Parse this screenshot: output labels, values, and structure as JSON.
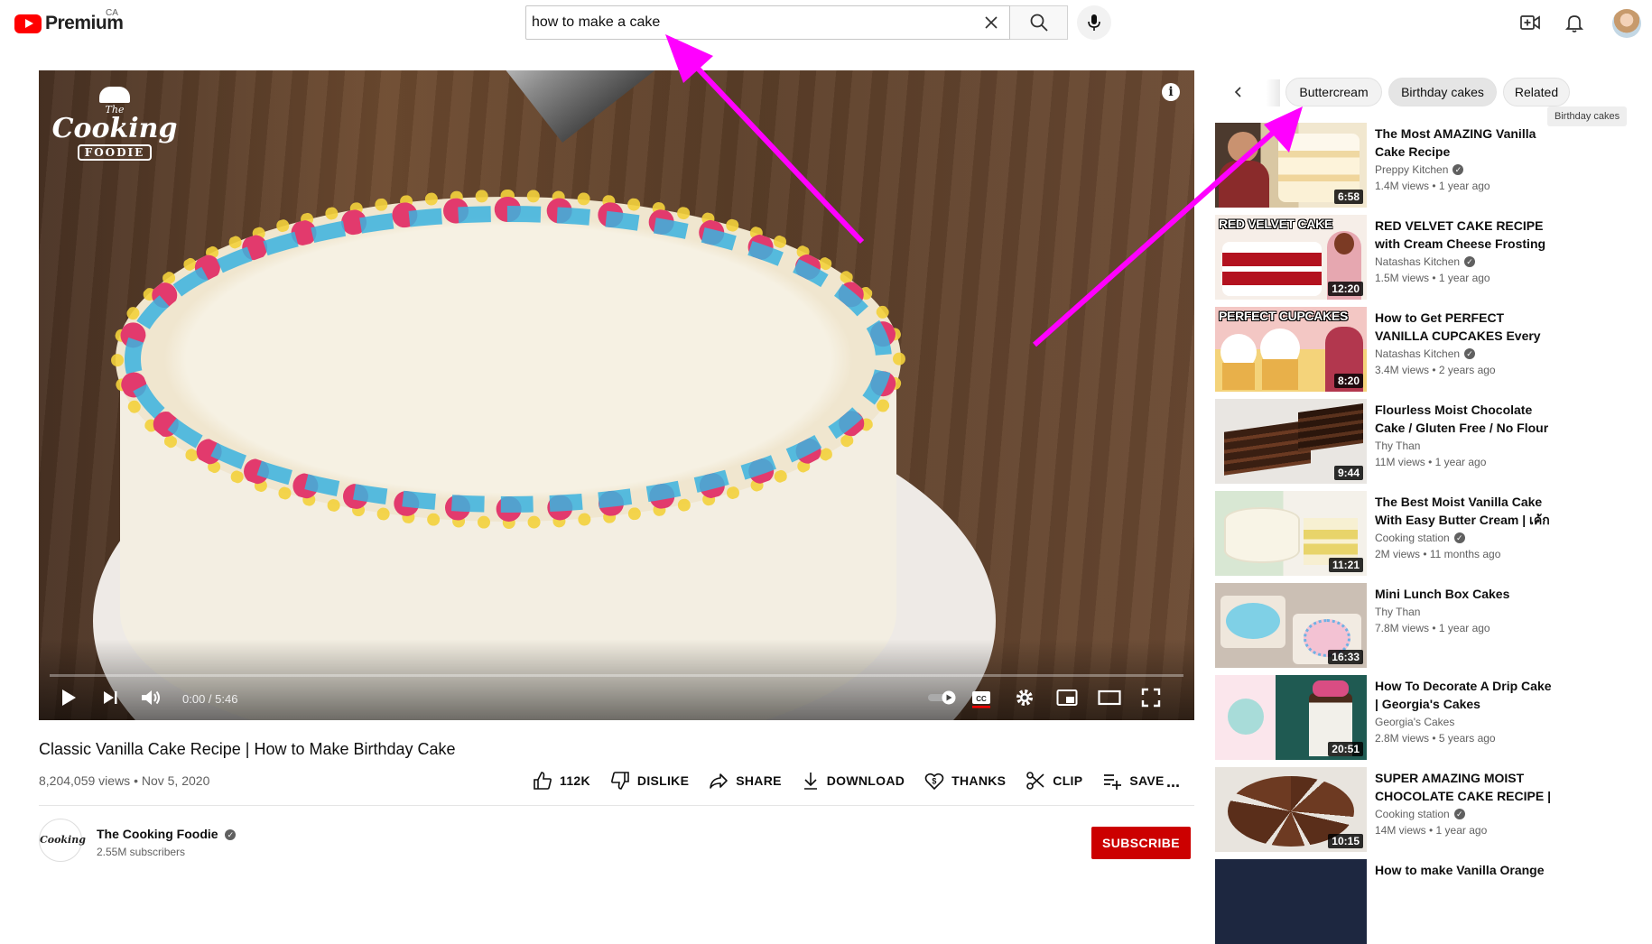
{
  "header": {
    "logo_text": "Premium",
    "country": "CA",
    "search_value": "how to make a cake",
    "icons": [
      "youtube-logo-icon",
      "close-icon",
      "search-icon",
      "mic-icon",
      "create-video-icon",
      "bell-icon",
      "avatar"
    ]
  },
  "player": {
    "logo": {
      "line1": "The",
      "line2": "Cooking",
      "line3": "FOODIE"
    },
    "info_label": "i",
    "time": "0:00 / 5:46",
    "progress": 0,
    "icons": [
      "play-icon",
      "next-icon",
      "volume-icon",
      "autoplay-toggle-icon",
      "captions-icon",
      "settings-icon",
      "miniplayer-icon",
      "theater-icon",
      "fullscreen-icon"
    ]
  },
  "video": {
    "title": "Classic Vanilla Cake Recipe | How to Make Birthday Cake",
    "meta": "8,204,059 views • Nov 5, 2020",
    "actions": {
      "like": "112K",
      "dislike": "DISLIKE",
      "share": "SHARE",
      "download": "DOWNLOAD",
      "thanks": "THANKS",
      "clip": "CLIP",
      "save": "SAVE"
    },
    "more": "..."
  },
  "channel": {
    "avatar_text": "Cooking",
    "name": "The Cooking Foodie",
    "subscribers": "2.55M subscribers",
    "subscribe_label": "SUBSCRIBE"
  },
  "chips": [
    {
      "label": "Buttercream"
    },
    {
      "label": "Birthday cakes"
    },
    {
      "label": "Related"
    }
  ],
  "tooltip": "Birthday cakes",
  "recommendations": [
    {
      "title": "The Most AMAZING Vanilla Cake Recipe",
      "channel": "Preppy Kitchen",
      "verified": true,
      "meta": "1.4M views • 1 year ago",
      "duration": "6:58",
      "overlay": ""
    },
    {
      "title": "RED VELVET CAKE RECIPE with Cream Cheese Frosting",
      "channel": "Natashas Kitchen",
      "verified": true,
      "meta": "1.5M views • 1 year ago",
      "duration": "12:20",
      "overlay": "RED VELVET CAKE"
    },
    {
      "title": "How to Get PERFECT VANILLA CUPCAKES Every Time",
      "channel": "Natashas Kitchen",
      "verified": true,
      "meta": "3.4M views • 2 years ago",
      "duration": "8:20",
      "overlay": "PERFECT CUPCAKES"
    },
    {
      "title": "Flourless Moist Chocolate Cake / Gluten Free / No Flour",
      "channel": "Thy Than",
      "verified": false,
      "meta": "11M views • 1 year ago",
      "duration": "9:44",
      "overlay": ""
    },
    {
      "title": "The Best Moist Vanilla Cake With Easy Butter Cream | เค้กว...",
      "channel": "Cooking station",
      "verified": true,
      "meta": "2M views • 11 months ago",
      "duration": "11:21",
      "overlay": ""
    },
    {
      "title": "Mini Lunch Box Cakes",
      "channel": "Thy Than",
      "verified": false,
      "meta": "7.8M views • 1 year ago",
      "duration": "16:33",
      "overlay": ""
    },
    {
      "title": "How To Decorate A Drip Cake | Georgia's Cakes",
      "channel": "Georgia's Cakes",
      "verified": false,
      "meta": "2.8M views • 5 years ago",
      "duration": "20:51",
      "overlay": ""
    },
    {
      "title": "SUPER AMAZING MOIST CHOCOLATE CAKE RECIPE | เ...",
      "channel": "Cooking station",
      "verified": true,
      "meta": "14M views • 1 year ago",
      "duration": "10:15",
      "overlay": ""
    },
    {
      "title": "How to make Vanilla Orange",
      "channel": "",
      "verified": false,
      "meta": "",
      "duration": "",
      "overlay": ""
    }
  ],
  "colors": {
    "brand_red": "#ff0000",
    "subscribe_red": "#cc0000",
    "annotation_arrow": "#ff00ff"
  }
}
